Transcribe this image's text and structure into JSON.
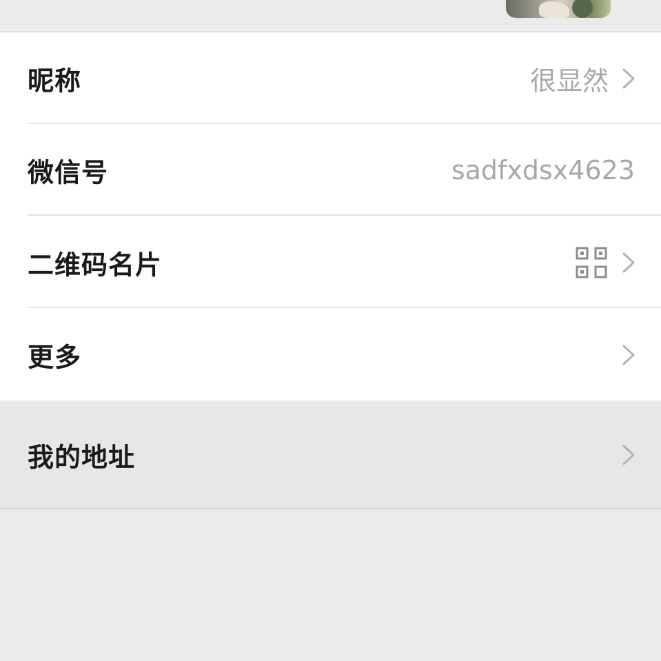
{
  "profile": {
    "nickname": {
      "label": "昵称",
      "value": "很显然"
    },
    "wechat_id": {
      "label": "微信号",
      "value": "sadfxdsx4623"
    },
    "qr_card": {
      "label": "二维码名片"
    },
    "more": {
      "label": "更多"
    },
    "address": {
      "label": "我的地址"
    }
  },
  "icons": {
    "chevron": "chevron-right-icon",
    "qr": "qr-code-icon",
    "avatar": "avatar-image"
  },
  "colors": {
    "background": "#ebebeb",
    "card": "#ffffff",
    "label_text": "#1a1a1a",
    "value_text": "#a8a8a8",
    "divider": "#e3e3e3",
    "chevron": "#b3b3b3"
  }
}
